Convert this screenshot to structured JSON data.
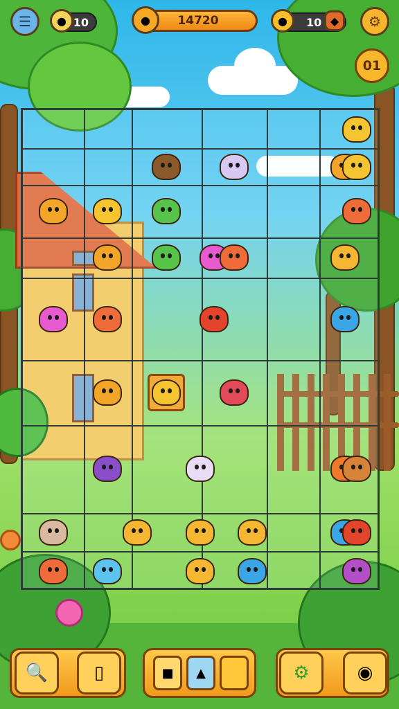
{
  "hud": {
    "lives": "10",
    "score": "14720",
    "coins": "10",
    "level": "01"
  },
  "icons": {
    "menu": "clipboard-icon",
    "life": "egg-icon",
    "score": "fruit-icon",
    "coin": "coin-icon",
    "bag": "pouch-icon",
    "settings": "gear-icon",
    "hint": "magnifier-icon",
    "shuffle": "eraser-icon",
    "power": "gear-power-icon",
    "bomb": "bomb-icon"
  },
  "board": {
    "rows": 9,
    "cols": 7,
    "tiles": [
      {
        "r": 0,
        "c": 6,
        "kind": "chick",
        "color": "#f5c431"
      },
      {
        "r": 1,
        "c": 2,
        "kind": "bear",
        "color": "#8a5a2b"
      },
      {
        "r": 1,
        "c": 3,
        "kind": "bird",
        "color": "#d8c9f2"
      },
      {
        "r": 1,
        "c": 5,
        "kind": "fox",
        "color": "#f3a52a"
      },
      {
        "r": 1,
        "c": 6,
        "kind": "duck",
        "color": "#f5c431"
      },
      {
        "r": 2,
        "c": 0,
        "kind": "cat",
        "color": "#f3a52a"
      },
      {
        "r": 2,
        "c": 1,
        "kind": "chick",
        "color": "#f5c431"
      },
      {
        "r": 2,
        "c": 2,
        "kind": "sprout",
        "color": "#56c34a"
      },
      {
        "r": 2,
        "c": 6,
        "kind": "fox",
        "color": "#ef6b3a"
      },
      {
        "r": 3,
        "c": 1,
        "kind": "squirrel",
        "color": "#f3a52a"
      },
      {
        "r": 3,
        "c": 2,
        "kind": "frog",
        "color": "#56c34a"
      },
      {
        "r": 3,
        "c": 2.7,
        "kind": "bird",
        "color": "#e85bd0"
      },
      {
        "r": 3,
        "c": 3,
        "kind": "boar",
        "color": "#ef6b3a"
      },
      {
        "r": 3,
        "c": 5,
        "kind": "chick",
        "color": "#f5b631"
      },
      {
        "r": 4,
        "c": 0,
        "kind": "bird",
        "color": "#e85bd0"
      },
      {
        "r": 4,
        "c": 1,
        "kind": "cat",
        "color": "#ef6b3a"
      },
      {
        "r": 4,
        "c": 2.7,
        "kind": "seahorse",
        "color": "#e2452c"
      },
      {
        "r": 4,
        "c": 5,
        "kind": "hippo",
        "color": "#3aa6e6"
      },
      {
        "r": 5,
        "c": 1,
        "kind": "fox",
        "color": "#f3a52a"
      },
      {
        "r": 5,
        "c": 2,
        "kind": "chick",
        "color": "#f5c431",
        "selected": true
      },
      {
        "r": 5,
        "c": 3,
        "kind": "pig",
        "color": "#e24a5a"
      },
      {
        "r": 6,
        "c": 1,
        "kind": "rhino",
        "color": "#8a4fc8"
      },
      {
        "r": 6,
        "c": 2.5,
        "kind": "ghost",
        "color": "#e8dcf6"
      },
      {
        "r": 6,
        "c": 5,
        "kind": "bear",
        "color": "#f07a2c"
      },
      {
        "r": 6,
        "c": 6,
        "kind": "squirrel",
        "color": "#d7843a"
      },
      {
        "r": 7,
        "c": 0,
        "kind": "rock",
        "color": "#d9b9a0"
      },
      {
        "r": 7,
        "c": 1.5,
        "kind": "seahorse",
        "color": "#f5b631"
      },
      {
        "r": 7,
        "c": 2.5,
        "kind": "chick",
        "color": "#f5b631"
      },
      {
        "r": 7,
        "c": 3.3,
        "kind": "boar",
        "color": "#f5b631"
      },
      {
        "r": 7,
        "c": 5,
        "kind": "hippo",
        "color": "#3aa6e6"
      },
      {
        "r": 7,
        "c": 6,
        "kind": "seahorse",
        "color": "#e2452c"
      },
      {
        "r": 8,
        "c": 0,
        "kind": "bear",
        "color": "#ef6b3a"
      },
      {
        "r": 8,
        "c": 1,
        "kind": "bird",
        "color": "#5cc2ee"
      },
      {
        "r": 8,
        "c": 2.5,
        "kind": "chick",
        "color": "#f5b631"
      },
      {
        "r": 8,
        "c": 3.3,
        "kind": "fish",
        "color": "#3aa6e6"
      },
      {
        "r": 8,
        "c": 6,
        "kind": "bear",
        "color": "#b24fc8"
      }
    ]
  }
}
